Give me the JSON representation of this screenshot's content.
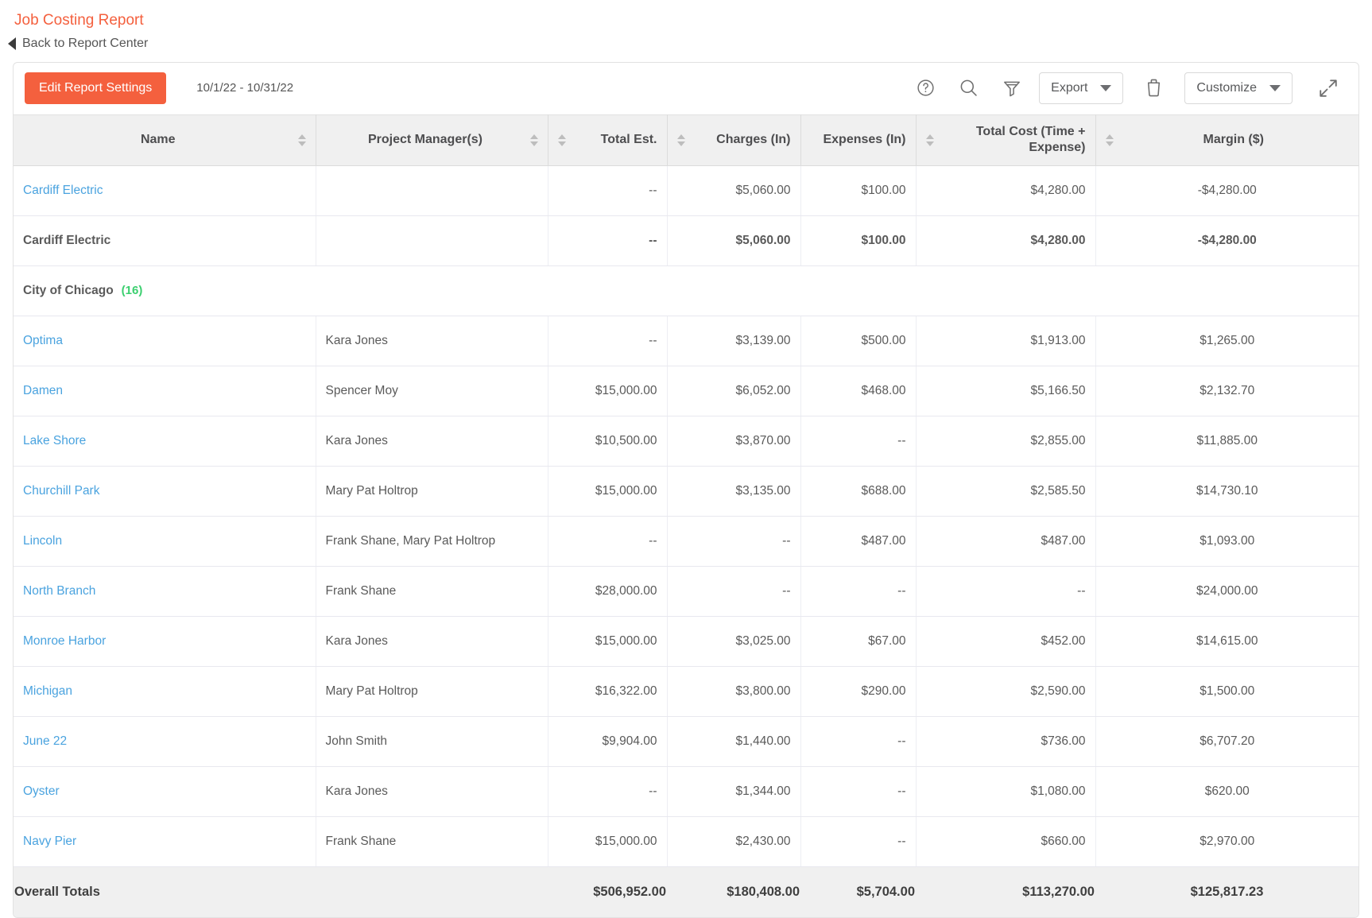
{
  "header": {
    "title": "Job Costing Report",
    "back_link": "Back to Report Center"
  },
  "toolbar": {
    "edit_settings_label": "Edit Report Settings",
    "date_range": "10/1/22 - 10/31/22",
    "help_icon": "help-circle-icon",
    "search_icon": "search-icon",
    "filter_icon": "filter-funnel-icon",
    "export_label": "Export",
    "delete_icon": "trash-icon",
    "customize_label": "Customize",
    "expand_icon": "expand-arrows-icon",
    "accent_color": "#f4603e"
  },
  "table": {
    "columns": [
      {
        "label": "Name",
        "align": "left",
        "sortable": true
      },
      {
        "label": "Project Manager(s)",
        "align": "left",
        "sortable": true
      },
      {
        "label": "Total Est.",
        "align": "right",
        "sortable": true
      },
      {
        "label": "Charges (In)",
        "align": "right",
        "sortable": true
      },
      {
        "label": "Expenses (In)",
        "align": "right",
        "sortable": false
      },
      {
        "label": "Total Cost (Time + Expense)",
        "align": "right",
        "sortable": true
      },
      {
        "label": "Margin ($)",
        "align": "right",
        "sortable": true
      }
    ],
    "rows": [
      {
        "type": "data",
        "name": "Cardiff Electric",
        "pm": "",
        "total_est": "--",
        "charges": "$5,060.00",
        "expenses": "$100.00",
        "total_cost": "$4,280.00",
        "margin": "-$4,280.00"
      },
      {
        "type": "subtotal",
        "name": "Cardiff Electric",
        "pm": "",
        "total_est": "--",
        "charges": "$5,060.00",
        "expenses": "$100.00",
        "total_cost": "$4,280.00",
        "margin": "-$4,280.00"
      },
      {
        "type": "group",
        "name": "City of Chicago",
        "count": "(16)"
      },
      {
        "type": "data",
        "name": "Optima",
        "pm": "Kara Jones",
        "total_est": "--",
        "charges": "$3,139.00",
        "expenses": "$500.00",
        "total_cost": "$1,913.00",
        "margin": "$1,265.00"
      },
      {
        "type": "data",
        "name": "Damen",
        "pm": "Spencer Moy",
        "total_est": "$15,000.00",
        "charges": "$6,052.00",
        "expenses": "$468.00",
        "total_cost": "$5,166.50",
        "margin": "$2,132.70"
      },
      {
        "type": "data",
        "name": "Lake Shore",
        "pm": "Kara Jones",
        "total_est": "$10,500.00",
        "charges": "$3,870.00",
        "expenses": "--",
        "total_cost": "$2,855.00",
        "margin": "$11,885.00"
      },
      {
        "type": "data",
        "name": "Churchill Park",
        "pm": "Mary Pat Holtrop",
        "total_est": "$15,000.00",
        "charges": "$3,135.00",
        "expenses": "$688.00",
        "total_cost": "$2,585.50",
        "margin": "$14,730.10"
      },
      {
        "type": "data",
        "name": "Lincoln",
        "pm": "Frank Shane, Mary Pat Holtrop",
        "total_est": "--",
        "charges": "--",
        "expenses": "$487.00",
        "total_cost": "$487.00",
        "margin": "$1,093.00"
      },
      {
        "type": "data",
        "name": "North Branch",
        "pm": "Frank Shane",
        "total_est": "$28,000.00",
        "charges": "--",
        "expenses": "--",
        "total_cost": "--",
        "margin": "$24,000.00"
      },
      {
        "type": "data",
        "name": "Monroe Harbor",
        "pm": "Kara Jones",
        "total_est": "$15,000.00",
        "charges": "$3,025.00",
        "expenses": "$67.00",
        "total_cost": "$452.00",
        "margin": "$14,615.00"
      },
      {
        "type": "data",
        "name": "Michigan",
        "pm": "Mary Pat Holtrop",
        "total_est": "$16,322.00",
        "charges": "$3,800.00",
        "expenses": "$290.00",
        "total_cost": "$2,590.00",
        "margin": "$1,500.00"
      },
      {
        "type": "data",
        "name": "June 22",
        "pm": "John Smith",
        "total_est": "$9,904.00",
        "charges": "$1,440.00",
        "expenses": "--",
        "total_cost": "$736.00",
        "margin": "$6,707.20"
      },
      {
        "type": "data",
        "name": "Oyster",
        "pm": "Kara Jones",
        "total_est": "--",
        "charges": "$1,344.00",
        "expenses": "--",
        "total_cost": "$1,080.00",
        "margin": "$620.00"
      },
      {
        "type": "data",
        "name": "Navy Pier",
        "pm": "Frank Shane",
        "total_est": "$15,000.00",
        "charges": "$2,430.00",
        "expenses": "--",
        "total_cost": "$660.00",
        "margin": "$2,970.00"
      }
    ],
    "overall": {
      "label": "Overall Totals",
      "pm": "",
      "total_est": "$506,952.00",
      "charges": "$180,408.00",
      "expenses": "$5,704.00",
      "total_cost": "$113,270.00",
      "margin": "$125,817.23"
    }
  }
}
